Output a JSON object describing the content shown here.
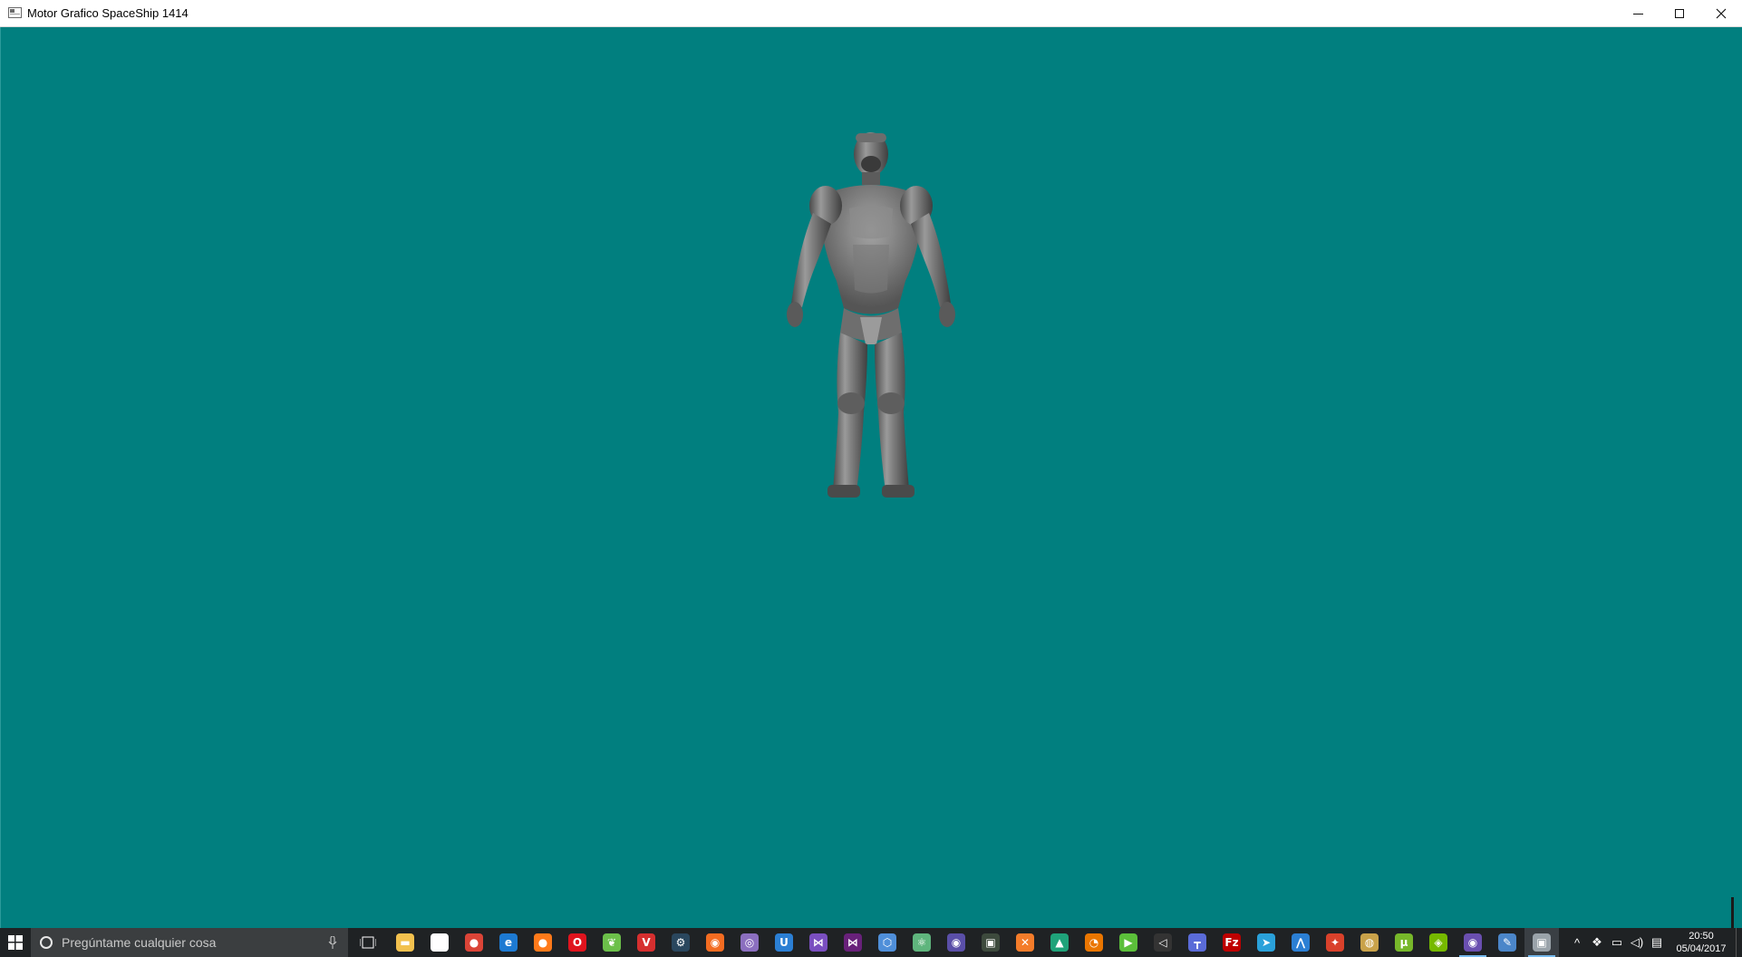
{
  "window": {
    "title": "Motor Grafico SpaceShip 1414",
    "background_color": "#017f7f"
  },
  "viewport": {
    "content": "grey armored humanoid 3D model",
    "model_color": "#8a8a8a"
  },
  "taskbar": {
    "search_placeholder": "Pregúntame cualquier cosa",
    "pinned_apps": [
      {
        "name": "file-explorer",
        "color": "#f2c14e",
        "glyph": "▬"
      },
      {
        "name": "store",
        "color": "#ffffff",
        "glyph": "▦"
      },
      {
        "name": "chrome",
        "color": "#db4437",
        "glyph": "●"
      },
      {
        "name": "edge",
        "color": "#1d7ad2",
        "glyph": "e"
      },
      {
        "name": "firefox",
        "color": "#ff7a1a",
        "glyph": "●"
      },
      {
        "name": "opera",
        "color": "#e0141e",
        "glyph": "O"
      },
      {
        "name": "leaf-app",
        "color": "#6cc04a",
        "glyph": "❦"
      },
      {
        "name": "vivaldi",
        "color": "#d62f2f",
        "glyph": "V"
      },
      {
        "name": "steam",
        "color": "#2a475e",
        "glyph": "⚙"
      },
      {
        "name": "origin",
        "color": "#f36c21",
        "glyph": "◉"
      },
      {
        "name": "agenda-app",
        "color": "#8b6fbf",
        "glyph": "◎"
      },
      {
        "name": "uplay",
        "color": "#2b7fd4",
        "glyph": "U"
      },
      {
        "name": "visual-studio",
        "color": "#7a4fc0",
        "glyph": "⋈"
      },
      {
        "name": "visual-studio-2",
        "color": "#68217a",
        "glyph": "⋈"
      },
      {
        "name": "3d-builder",
        "color": "#4f8fd9",
        "glyph": "⬡"
      },
      {
        "name": "atom",
        "color": "#5fb57d",
        "glyph": "⚛"
      },
      {
        "name": "purple-circle-app",
        "color": "#5a4fa8",
        "glyph": "◉"
      },
      {
        "name": "terminal-app",
        "color": "#3d4a3d",
        "glyph": "▣"
      },
      {
        "name": "xampp",
        "color": "#f47c2a",
        "glyph": "✕"
      },
      {
        "name": "triangle-app",
        "color": "#1fa37a",
        "glyph": "▲"
      },
      {
        "name": "blender",
        "color": "#ea7600",
        "glyph": "◔"
      },
      {
        "name": "green-play-app",
        "color": "#5bbf3a",
        "glyph": "▶"
      },
      {
        "name": "unity",
        "color": "#333333",
        "glyph": "◁"
      },
      {
        "name": "trello-like-app",
        "color": "#5a6bd8",
        "glyph": "┳"
      },
      {
        "name": "filezilla",
        "color": "#bf0000",
        "glyph": "Fz"
      },
      {
        "name": "telegram",
        "color": "#2aa1da",
        "glyph": "➤"
      },
      {
        "name": "arduino-like-app",
        "color": "#2b7fd4",
        "glyph": "⋀"
      },
      {
        "name": "red-bird-app",
        "color": "#d9412b",
        "glyph": "✦"
      },
      {
        "name": "globe-app",
        "color": "#c9a24a",
        "glyph": "◍"
      },
      {
        "name": "utorrent",
        "color": "#77b82a",
        "glyph": "µ"
      },
      {
        "name": "nvidia",
        "color": "#76b900",
        "glyph": "◈"
      },
      {
        "name": "purple-app-running",
        "color": "#6a4fb0",
        "glyph": "◉"
      },
      {
        "name": "paint-app",
        "color": "#4b86c9",
        "glyph": "✎"
      },
      {
        "name": "engine-window",
        "color": "#9aa3aa",
        "glyph": "▣"
      }
    ],
    "clock": {
      "time": "20:50",
      "date": "05/04/2017"
    }
  }
}
